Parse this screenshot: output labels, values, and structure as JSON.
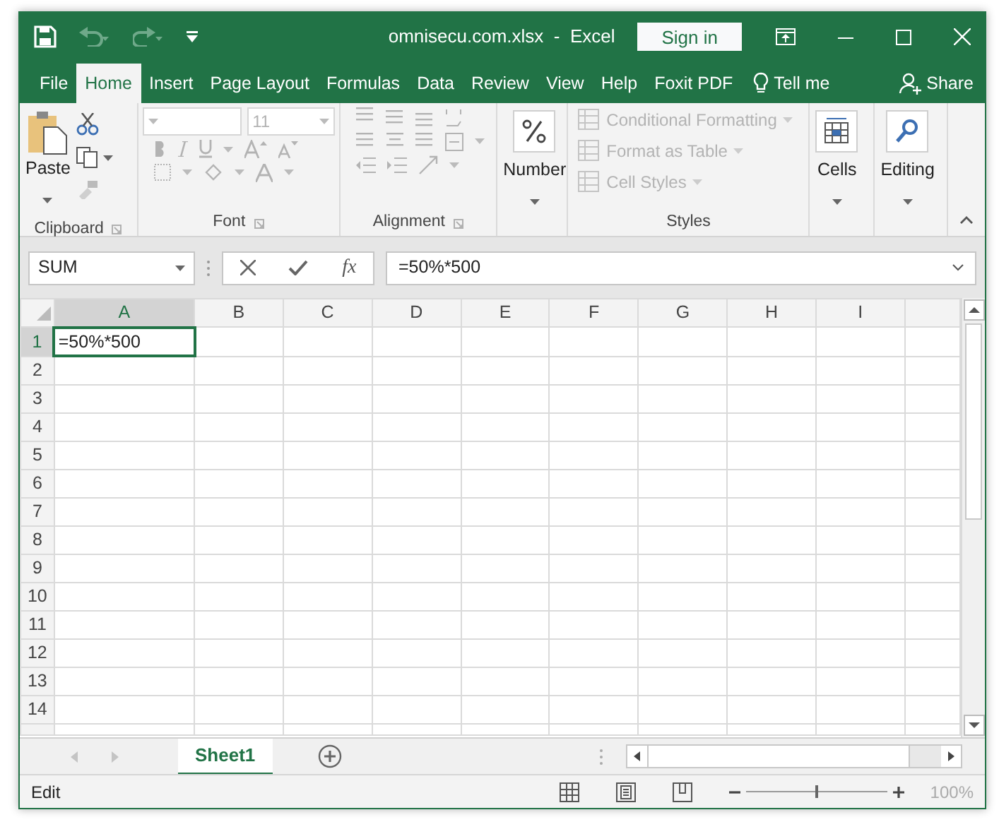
{
  "window": {
    "title": "omnisecu.com.xlsx  -  Excel",
    "sign_in": "Sign in"
  },
  "quick_access": [
    {
      "kind": "save",
      "disabled": false
    },
    {
      "kind": "undo",
      "disabled": true
    },
    {
      "kind": "redo",
      "disabled": true
    },
    {
      "kind": "customize",
      "disabled": false
    }
  ],
  "tabs": [
    {
      "label": "File",
      "selected": false
    },
    {
      "label": "Home",
      "selected": true
    },
    {
      "label": "Insert",
      "selected": false
    },
    {
      "label": "Page Layout",
      "selected": false
    },
    {
      "label": "Formulas",
      "selected": false
    },
    {
      "label": "Data",
      "selected": false
    },
    {
      "label": "Review",
      "selected": false
    },
    {
      "label": "View",
      "selected": false
    },
    {
      "label": "Help",
      "selected": false
    },
    {
      "label": "Foxit PDF",
      "selected": false
    }
  ],
  "tell_me": "Tell me",
  "share": "Share",
  "ribbon": {
    "groups": [
      {
        "kind": "clipboard",
        "label": "Clipboard",
        "button": "Paste"
      },
      {
        "kind": "font",
        "label": "Font",
        "font_size": "11",
        "disabled": true
      },
      {
        "kind": "alignment",
        "label": "Alignment",
        "disabled": true
      },
      {
        "kind": "number",
        "button": "Number"
      },
      {
        "kind": "styles",
        "label": "Styles",
        "commands": [
          {
            "label": "Conditional Formatting",
            "disabled": true
          },
          {
            "label": "Format as Table",
            "disabled": true
          },
          {
            "label": "Cell Styles",
            "disabled": true
          }
        ]
      },
      {
        "kind": "cells",
        "button": "Cells"
      },
      {
        "kind": "editing",
        "button": "Editing"
      }
    ]
  },
  "formula_bar": {
    "name_box": "SUM",
    "function_label": "fx",
    "formula": "=50%*500"
  },
  "sheet": {
    "columns": [
      {
        "label": "A",
        "selected": true
      },
      {
        "label": "B",
        "selected": false
      },
      {
        "label": "C",
        "selected": false
      },
      {
        "label": "D",
        "selected": false
      },
      {
        "label": "E",
        "selected": false
      },
      {
        "label": "F",
        "selected": false
      },
      {
        "label": "G",
        "selected": false
      },
      {
        "label": "H",
        "selected": false
      },
      {
        "label": "I",
        "selected": false
      }
    ],
    "rows": [
      {
        "label": "1",
        "selected": true,
        "cells": [
          {
            "value": "=50%*500",
            "selected": true
          }
        ]
      },
      {
        "label": "2",
        "selected": false
      },
      {
        "label": "3",
        "selected": false
      },
      {
        "label": "4",
        "selected": false
      },
      {
        "label": "5",
        "selected": false
      },
      {
        "label": "6",
        "selected": false
      },
      {
        "label": "7",
        "selected": false
      },
      {
        "label": "8",
        "selected": false
      },
      {
        "label": "9",
        "selected": false
      },
      {
        "label": "10",
        "selected": false
      },
      {
        "label": "11",
        "selected": false
      },
      {
        "label": "12",
        "selected": false
      },
      {
        "label": "13",
        "selected": false
      },
      {
        "label": "14",
        "selected": false
      }
    ]
  },
  "sheet_tabs": [
    {
      "label": "Sheet1",
      "selected": true
    }
  ],
  "status_bar": {
    "mode": "Edit",
    "zoom_slider": {
      "level": 0.5
    },
    "zoom": "100%"
  }
}
